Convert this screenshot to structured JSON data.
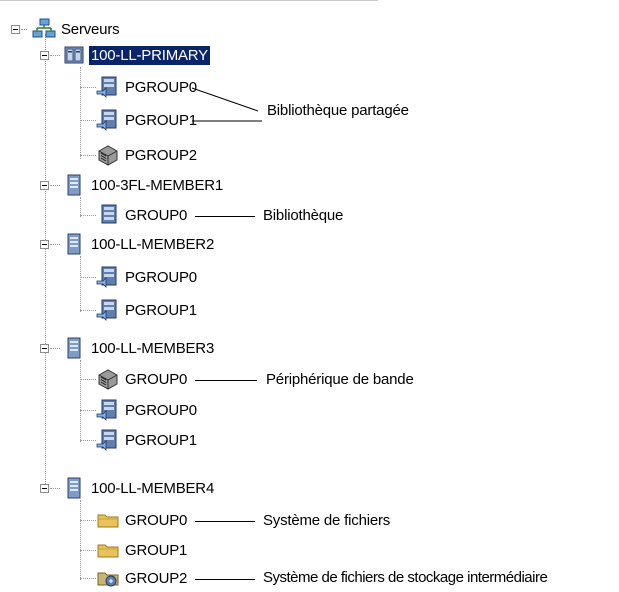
{
  "root": {
    "label": "Serveurs",
    "icon": "server-network-icon"
  },
  "servers": [
    {
      "label": "100-LL-PRIMARY",
      "icon": "primary-server-icon",
      "selected": true,
      "children": [
        {
          "label": "PGROUP0",
          "icon": "shared-library-icon"
        },
        {
          "label": "PGROUP1",
          "icon": "shared-library-icon"
        },
        {
          "label": "PGROUP2",
          "icon": "tape-device-icon"
        }
      ]
    },
    {
      "label": "100-3FL-MEMBER1",
      "icon": "member-server-icon",
      "children": [
        {
          "label": "GROUP0",
          "icon": "library-icon"
        }
      ]
    },
    {
      "label": "100-LL-MEMBER2",
      "icon": "member-server-icon",
      "children": [
        {
          "label": "PGROUP0",
          "icon": "shared-library-icon"
        },
        {
          "label": "PGROUP1",
          "icon": "shared-library-icon"
        }
      ]
    },
    {
      "label": "100-LL-MEMBER3",
      "icon": "member-server-icon",
      "children": [
        {
          "label": "GROUP0",
          "icon": "tape-device-icon"
        },
        {
          "label": "PGROUP0",
          "icon": "shared-library-icon"
        },
        {
          "label": "PGROUP1",
          "icon": "shared-library-icon"
        }
      ]
    },
    {
      "label": "100-LL-MEMBER4",
      "icon": "member-server-icon",
      "children": [
        {
          "label": "GROUP0",
          "icon": "file-system-folder-icon"
        },
        {
          "label": "GROUP1",
          "icon": "file-system-folder-icon"
        },
        {
          "label": "GROUP2",
          "icon": "staging-folder-icon"
        }
      ]
    }
  ],
  "annotations": {
    "shared_library": "Bibliothèque partagée",
    "library": "Bibliothèque",
    "tape_device": "Périphérique de bande",
    "file_system": "Système de fichiers",
    "staging": "Système de fichiers de stockage intermédiaire"
  },
  "colors": {
    "selection": "#0a246a",
    "folder": "#e8c25a",
    "server": "#5e7fb0"
  }
}
